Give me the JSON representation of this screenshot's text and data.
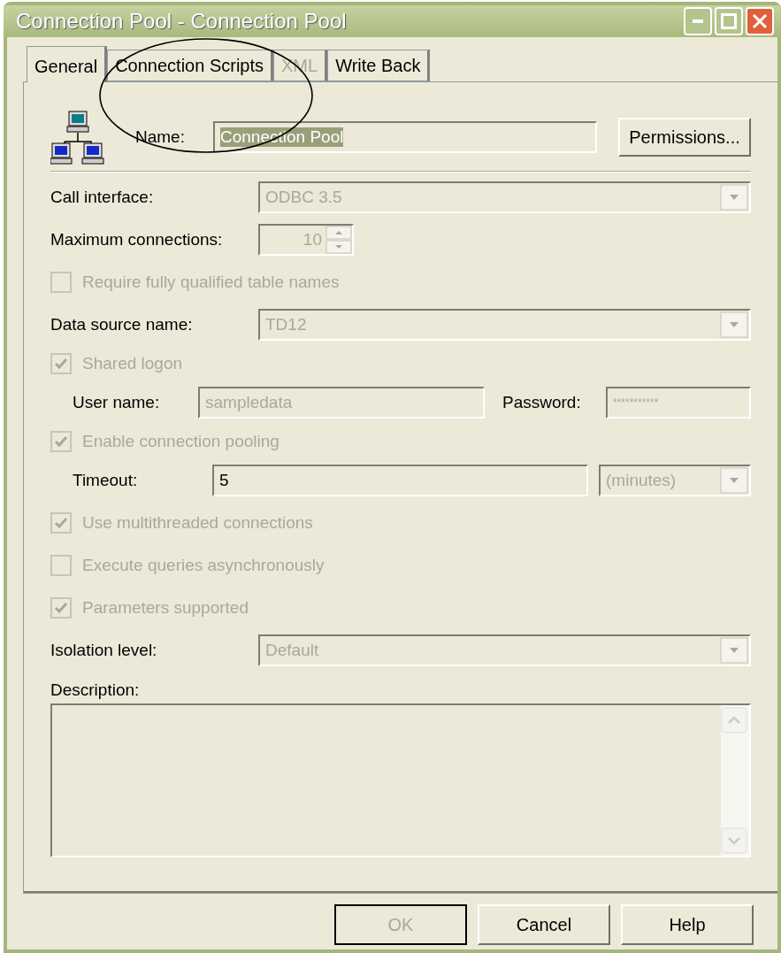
{
  "window": {
    "title": "Connection Pool - Connection Pool"
  },
  "tabs": [
    {
      "label": "General",
      "selected": true,
      "disabled": false
    },
    {
      "label": "Connection Scripts",
      "selected": false,
      "disabled": false
    },
    {
      "label": "XML",
      "selected": false,
      "disabled": true
    },
    {
      "label": "Write Back",
      "selected": false,
      "disabled": false
    }
  ],
  "name": {
    "label": "Name:",
    "value": "Connection Pool"
  },
  "permissions_button": "Permissions...",
  "rows": [
    {
      "kind": "combo",
      "label": "Call interface:",
      "value": "ODBC 3.5",
      "disabled": true
    },
    {
      "kind": "spin",
      "label": "Maximum connections:",
      "value": "10",
      "disabled": true
    },
    {
      "kind": "check",
      "label": "Require fully qualified table names",
      "checked": false,
      "disabled": true
    },
    {
      "kind": "combo",
      "label": "Data source name:",
      "value": "TD12",
      "disabled": true
    },
    {
      "kind": "check",
      "label": "Shared logon",
      "checked": true,
      "disabled": true
    },
    {
      "kind": "pair",
      "label": "User name:",
      "value": "sampledata",
      "label2": "Password:",
      "value2": "***********",
      "disabled": true
    },
    {
      "kind": "check",
      "label": "Enable connection pooling",
      "checked": true,
      "disabled": true
    },
    {
      "kind": "timeout",
      "label": "Timeout:",
      "value": "5",
      "unit": "(minutes)",
      "disabled": false
    },
    {
      "kind": "check",
      "label": "Use multithreaded connections",
      "checked": true,
      "disabled": true
    },
    {
      "kind": "check",
      "label": "Execute queries asynchronously",
      "checked": false,
      "disabled": true
    },
    {
      "kind": "check",
      "label": "Parameters supported",
      "checked": true,
      "disabled": true
    },
    {
      "kind": "combo",
      "label": "Isolation level:",
      "value": "Default",
      "disabled": true
    }
  ],
  "description": {
    "label": "Description:"
  },
  "buttons": [
    {
      "label": "OK",
      "disabled": true
    },
    {
      "label": "Cancel",
      "disabled": false
    },
    {
      "label": "Help",
      "disabled": false
    }
  ]
}
